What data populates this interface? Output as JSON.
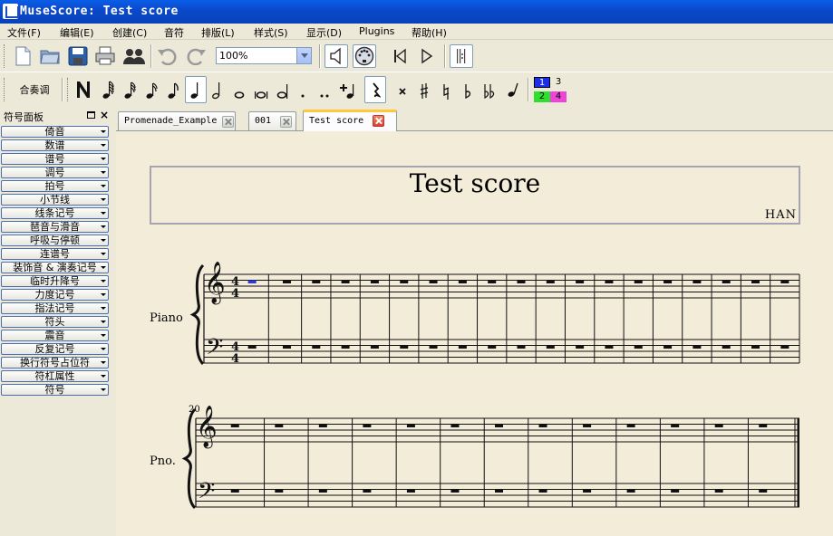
{
  "window": {
    "title": "MuseScore: Test score"
  },
  "menu": [
    "文件(F)",
    "编辑(E)",
    "创建(C)",
    "音符",
    "排版(L)",
    "样式(S)",
    "显示(D)",
    "Plugins",
    "帮助(H)"
  ],
  "toolbar": {
    "zoom_value": "100%",
    "concert_pitch_label": "合奏调",
    "voices": [
      "1",
      "2",
      "3",
      "4"
    ],
    "voice_colors": {
      "1": "#1c2ee6",
      "2": "#2ee02e",
      "3": "#f4f0c6",
      "4": "#ee44d8"
    }
  },
  "palette": {
    "title": "符号面板",
    "items": [
      "倚音",
      "数谱",
      "谱号",
      "调号",
      "拍号",
      "小节线",
      "线条记号",
      "琶音与滑音",
      "呼吸与停顿",
      "连谱号",
      "装饰音 & 演奏记号",
      "临时升降号",
      "力度记号",
      "指法记号",
      "符头",
      "震音",
      "反复记号",
      "换行符号占位符",
      "符杠属性",
      "符号"
    ]
  },
  "tabs": [
    {
      "label": "Promenade_Example",
      "active": false
    },
    {
      "label": "001",
      "active": false
    },
    {
      "label": "Test score",
      "active": true
    }
  ],
  "score": {
    "title": "Test score",
    "composer": "HAN",
    "system1_instrument": "Piano",
    "system2_instrument": "Pno.",
    "system2_measure_number": "20",
    "time_signature": "4/4",
    "system1_measures": 19,
    "system2_measures": 13,
    "accent_color": "#2a3adf"
  }
}
